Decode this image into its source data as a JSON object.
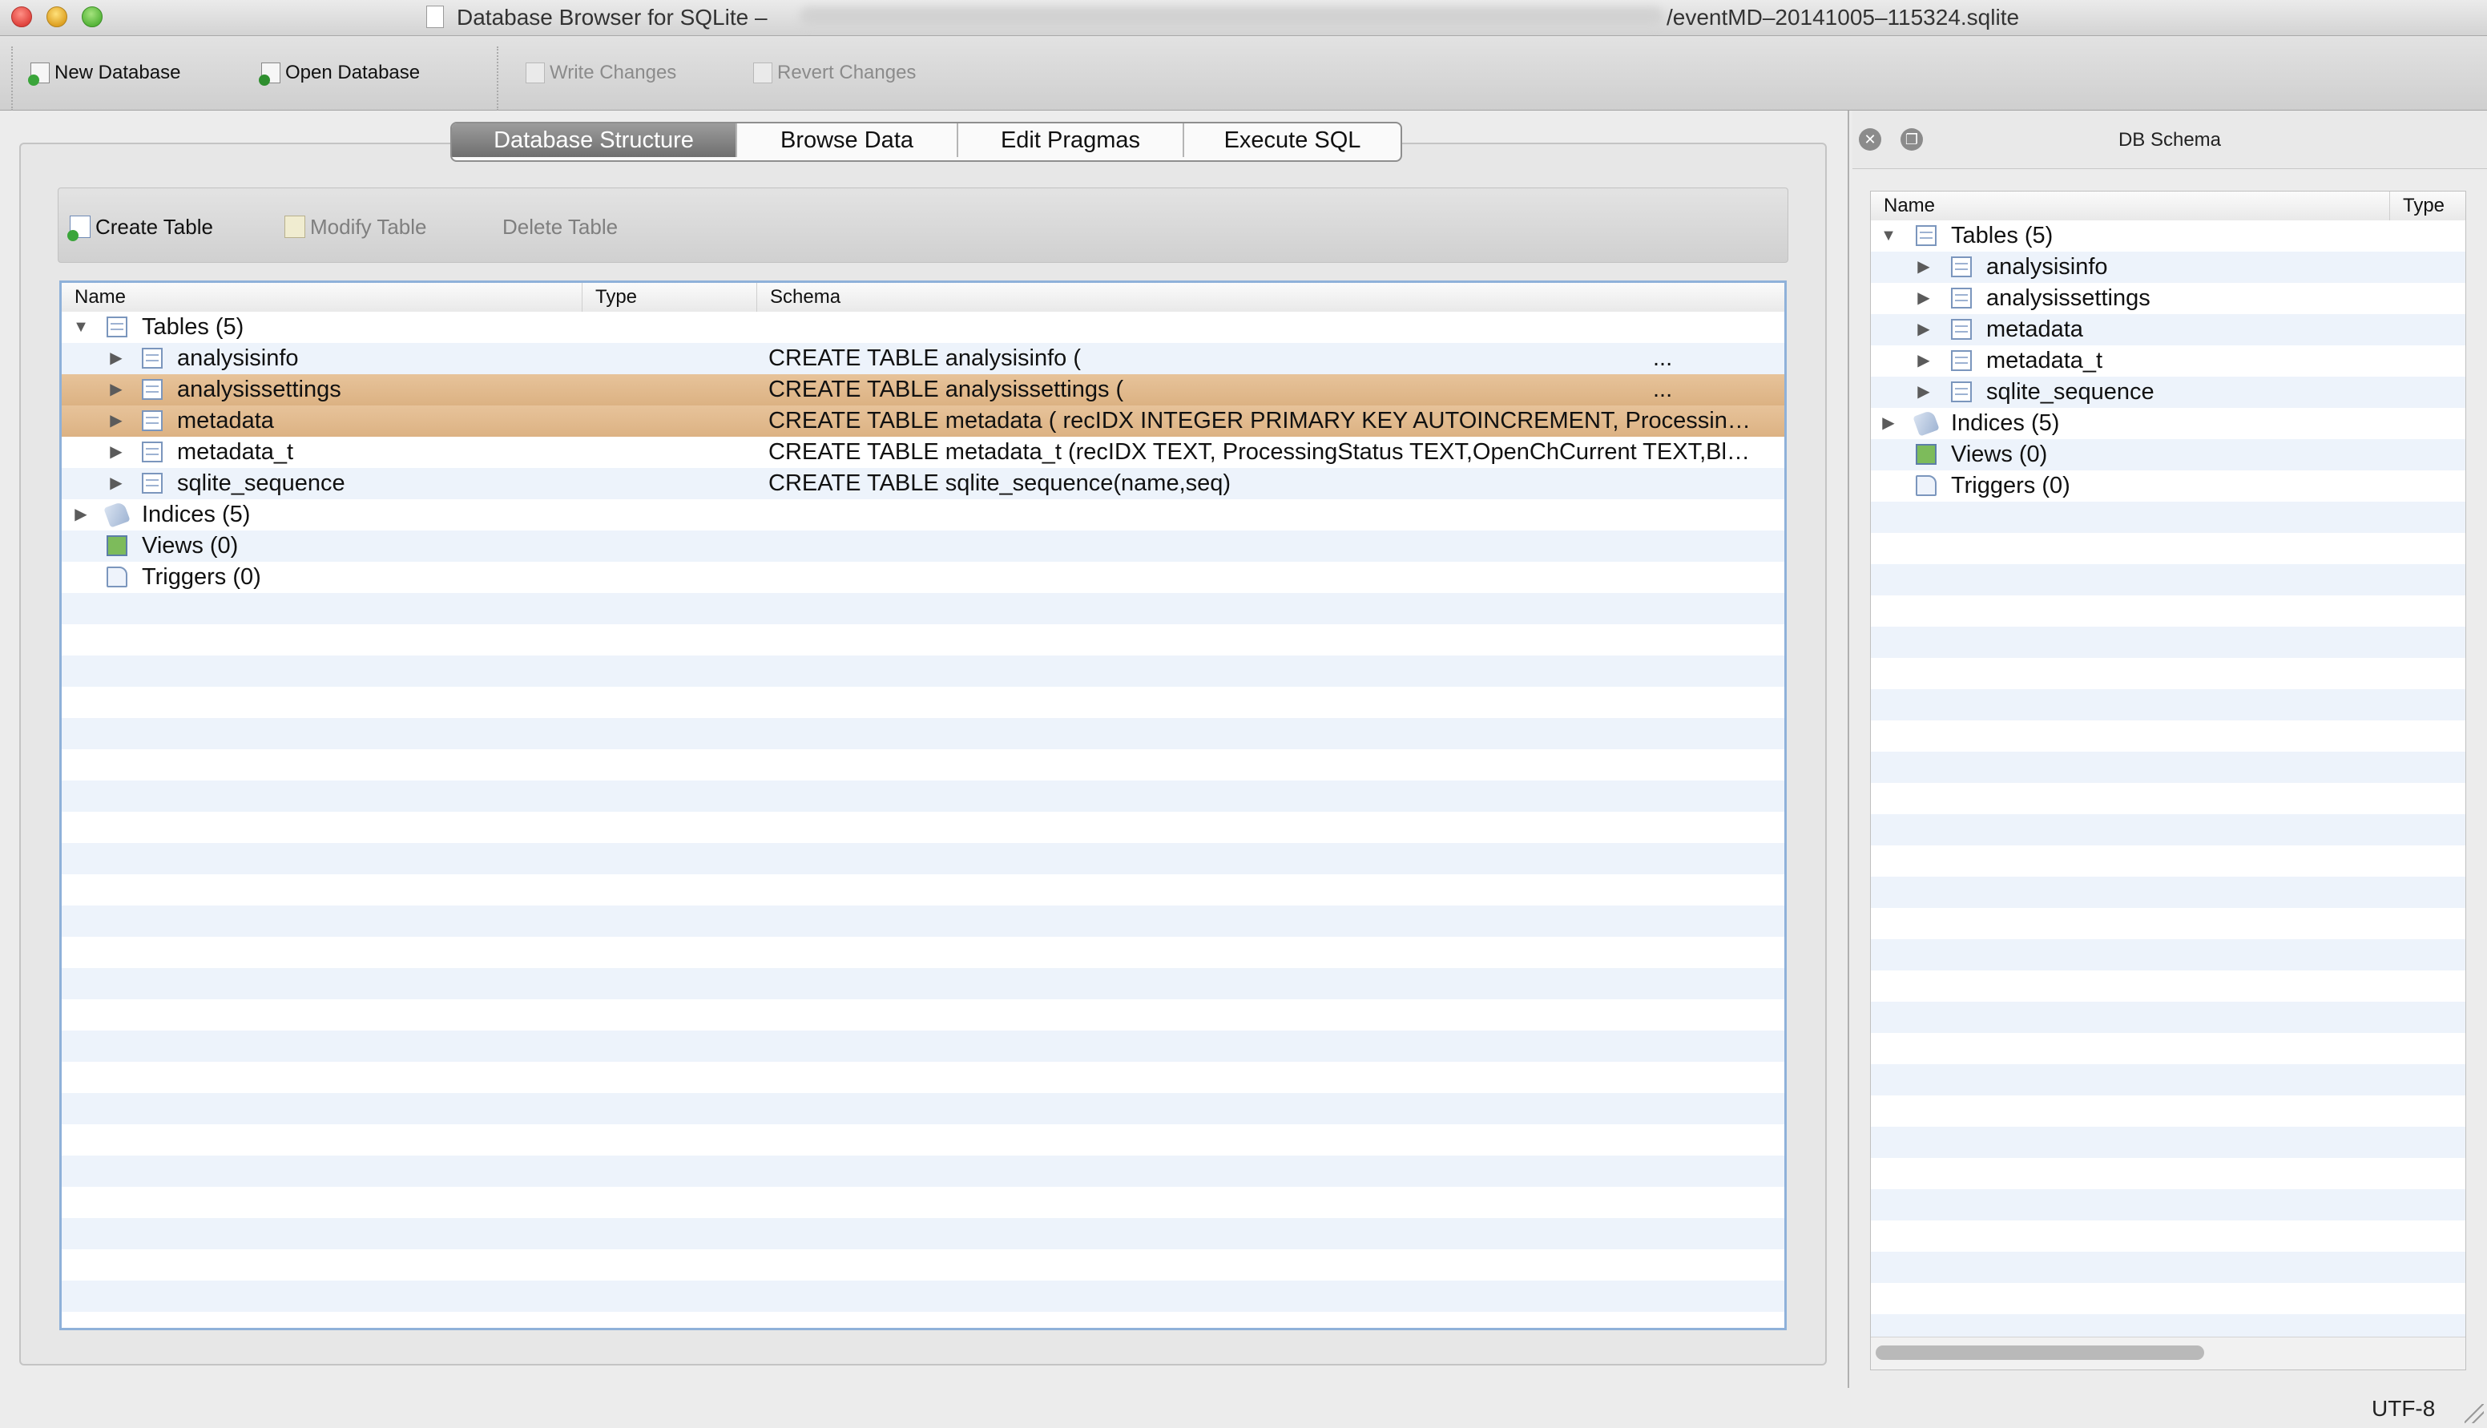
{
  "window": {
    "title_prefix": "Database Browser for SQLite –",
    "title_file": "/eventMD–20141005–115324.sqlite"
  },
  "toolbar": {
    "new_database": "New Database",
    "open_database": "Open Database",
    "write_changes": "Write Changes",
    "revert_changes": "Revert Changes"
  },
  "tabs": [
    "Database Structure",
    "Browse Data",
    "Edit Pragmas",
    "Execute SQL"
  ],
  "active_tab": "Database Structure",
  "structure_toolbar": {
    "create_table": "Create Table",
    "modify_table": "Modify Table",
    "delete_table": "Delete Table"
  },
  "tree": {
    "columns": [
      "Name",
      "Type",
      "Schema"
    ],
    "tables_label": "Tables (5)",
    "tables": [
      {
        "name": "analysisinfo",
        "schema": "CREATE TABLE analysisinfo (",
        "ellipsis": "...",
        "highlighted": false
      },
      {
        "name": "analysissettings",
        "schema": "CREATE TABLE analysissettings (",
        "ellipsis": "...",
        "highlighted": true
      },
      {
        "name": "metadata",
        "schema": "CREATE TABLE metadata ( recIDX INTEGER PRIMARY KEY AUTOINCREMENT, ProcessingStatu...",
        "ellipsis": "",
        "highlighted": true
      },
      {
        "name": "metadata_t",
        "schema": "CREATE TABLE metadata_t (recIDX TEXT, ProcessingStatus TEXT,OpenChCurrent TEXT,Bloc...",
        "ellipsis": "",
        "highlighted": false
      },
      {
        "name": "sqlite_sequence",
        "schema": "CREATE TABLE sqlite_sequence(name,seq)",
        "ellipsis": "",
        "highlighted": false
      }
    ],
    "indices_label": "Indices (5)",
    "views_label": "Views (0)",
    "triggers_label": "Triggers (0)"
  },
  "dock": {
    "title": "DB Schema",
    "columns": [
      "Name",
      "Type"
    ],
    "tables_label": "Tables (5)",
    "tables": [
      "analysisinfo",
      "analysissettings",
      "metadata",
      "metadata_t",
      "sqlite_sequence"
    ],
    "indices_label": "Indices (5)",
    "views_label": "Views (0)",
    "triggers_label": "Triggers (0)"
  },
  "status": {
    "encoding": "UTF-8"
  }
}
